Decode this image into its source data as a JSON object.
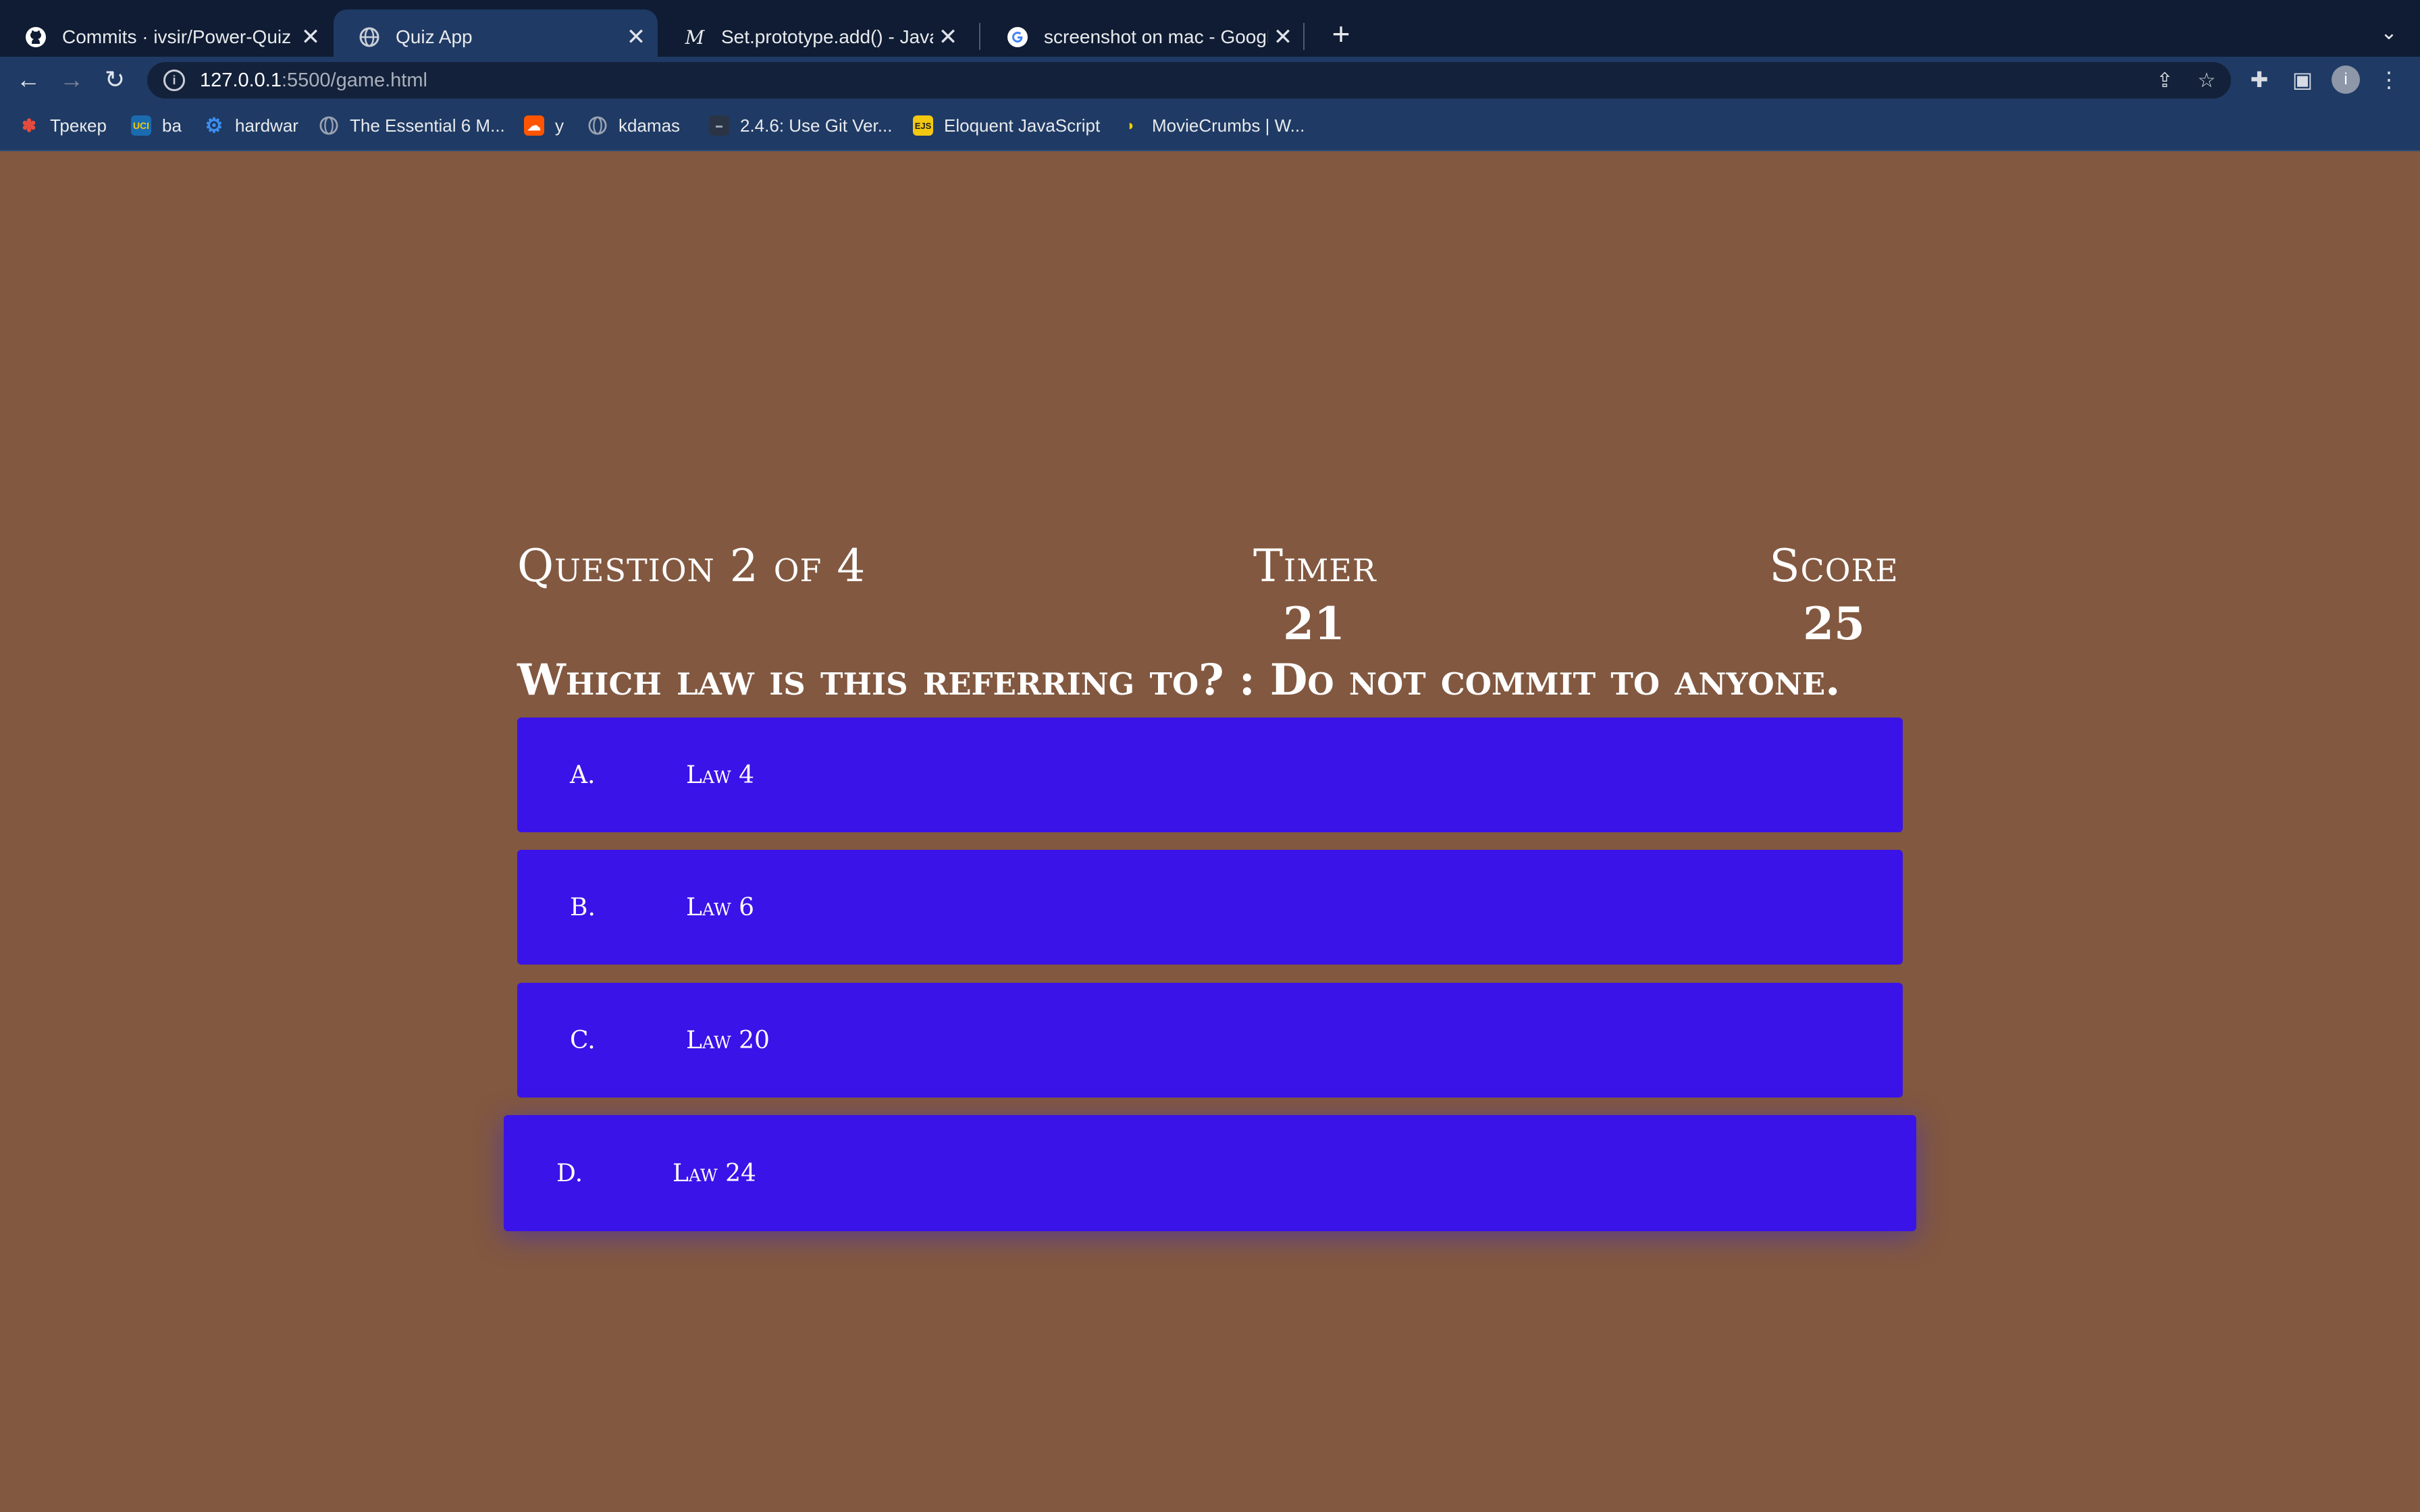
{
  "browser": {
    "tabs": [
      {
        "title": "Commits · ivsir/Power-Quiz",
        "icon": "github-icon",
        "active": false
      },
      {
        "title": "Quiz App",
        "icon": "globe-icon",
        "active": true
      },
      {
        "title": "Set.prototype.add() - JavaScrip",
        "icon": "mdn-icon",
        "active": false
      },
      {
        "title": "screenshot on mac - Google Se",
        "icon": "google-icon",
        "active": false
      }
    ],
    "url_host": "127.0.0.1",
    "url_path": ":5500/game.html",
    "avatar_letter": "i",
    "bookmarks": [
      {
        "label": "Трекер",
        "icon": "tracker-icon",
        "color": "#e94b3c"
      },
      {
        "label": "ba",
        "icon": "uci-icon",
        "color": "#1b6bb0",
        "badge": "UCI"
      },
      {
        "label": "hardwar",
        "icon": "gear-icon",
        "color": "#3a8ef0"
      },
      {
        "label": "The Essential 6 M...",
        "icon": "globe-icon",
        "color": "#9aa3b2"
      },
      {
        "label": "y",
        "icon": "soundcloud-icon",
        "color": "#ff5500"
      },
      {
        "label": "kdamas",
        "icon": "globe-icon",
        "color": "#9aa3b2"
      },
      {
        "label": "2.4.6: Use Git Ver...",
        "icon": "site-icon",
        "color": "#2b3445"
      },
      {
        "label": "Eloquent JavaScript",
        "icon": "ejs-icon",
        "color": "#f2c811",
        "badge": "EJS"
      },
      {
        "label": "MovieCrumbs | W...",
        "icon": "moviecrumbs-icon",
        "color": "#f5d000"
      }
    ],
    "colors": {
      "tabbar": "#0f1c33",
      "toolbar": "#1f3a64"
    }
  },
  "quiz": {
    "progress_label": "Question 2 of 4",
    "timer_label": "Timer",
    "timer_value": "21",
    "score_label": "Score",
    "score_value": "25",
    "question": "Which law is this referring to? : Do not commit to anyone.",
    "choices": [
      {
        "prefix": "A.",
        "text": "Law 4"
      },
      {
        "prefix": "B.",
        "text": "Law 6"
      },
      {
        "prefix": "C.",
        "text": "Law 20"
      },
      {
        "prefix": "D.",
        "text": "Law 24"
      }
    ],
    "colors": {
      "background": "#825840",
      "choice": "#3a13e8",
      "text": "#ffffff"
    }
  }
}
